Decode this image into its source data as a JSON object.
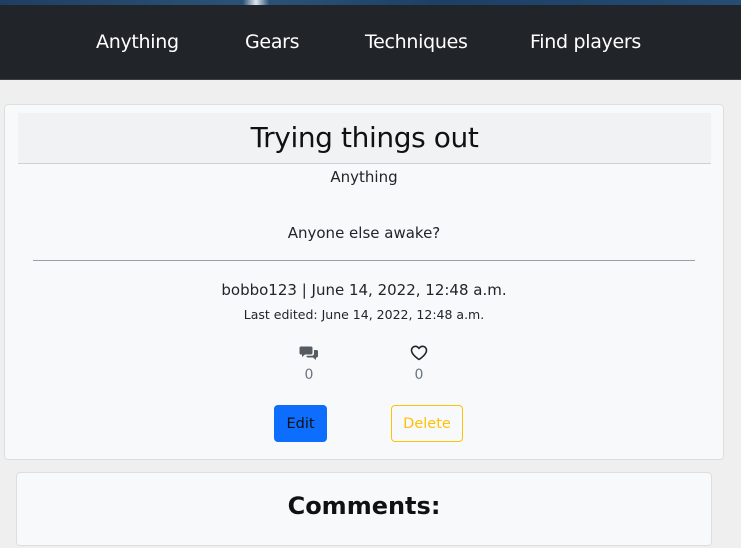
{
  "nav": {
    "items": [
      {
        "label": "Anything"
      },
      {
        "label": "Gears"
      },
      {
        "label": "Techniques"
      },
      {
        "label": "Find players"
      }
    ]
  },
  "post": {
    "title": "Trying things out",
    "category": "Anything",
    "body": "Anyone else awake?",
    "meta": "bobbo123 | June 14, 2022, 12:48 a.m.",
    "last_edited": "Last edited: June 14, 2022, 12:48 a.m.",
    "comment_count": "0",
    "like_count": "0",
    "comment_icon": "comments-icon",
    "like_icon": "heart-outline-icon",
    "edit_label": "Edit",
    "delete_label": "Delete"
  },
  "comments": {
    "heading": "Comments:"
  },
  "colors": {
    "navbar_bg": "#212529",
    "edit_button": "#0d6efd",
    "delete_button": "#ffc107",
    "page_bg": "#efefef",
    "card_bg": "#f8f9fa"
  }
}
